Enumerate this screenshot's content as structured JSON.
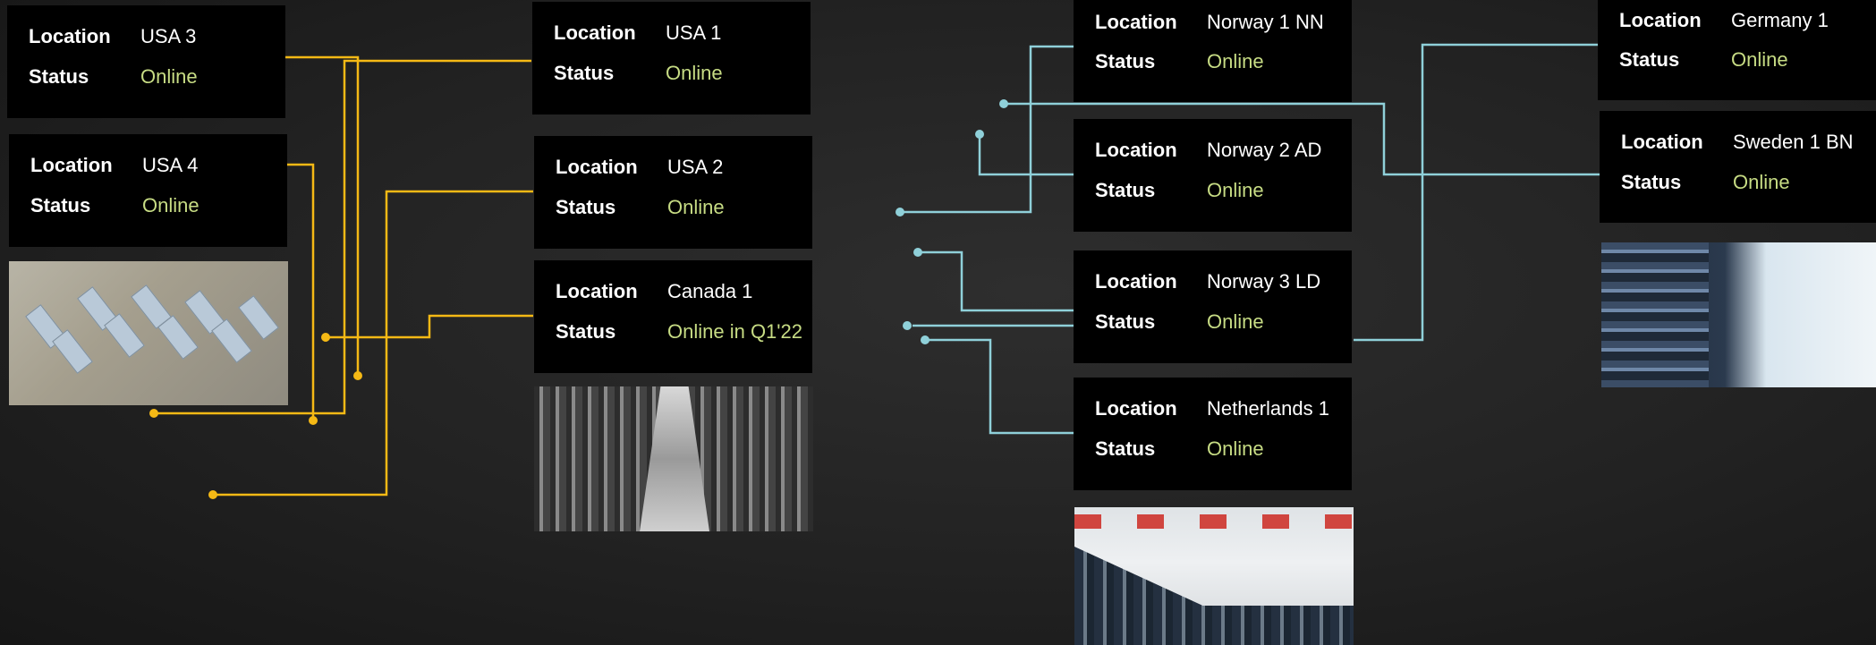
{
  "labels": {
    "location": "Location",
    "status": "Status"
  },
  "colors": {
    "americas_line": "#f5b915",
    "europe_line": "#8fd0d9",
    "status_text": "#c7dc84",
    "card_bg": "#000000"
  },
  "sites": [
    {
      "id": "usa3",
      "location": "USA 3",
      "status": "Online",
      "region": "americas"
    },
    {
      "id": "usa4",
      "location": "USA 4",
      "status": "Online",
      "region": "americas"
    },
    {
      "id": "usa1",
      "location": "USA 1",
      "status": "Online",
      "region": "americas"
    },
    {
      "id": "usa2",
      "location": "USA 2",
      "status": "Online",
      "region": "americas"
    },
    {
      "id": "canada1",
      "location": "Canada 1",
      "status": "Online in Q1'22",
      "region": "americas"
    },
    {
      "id": "norway1",
      "location": "Norway 1 NN",
      "status": "Online",
      "region": "europe"
    },
    {
      "id": "norway2",
      "location": "Norway 2 AD",
      "status": "Online",
      "region": "europe"
    },
    {
      "id": "norway3",
      "location": "Norway 3 LD",
      "status": "Online",
      "region": "europe"
    },
    {
      "id": "netherlands1",
      "location": "Netherlands  1",
      "status": "Online",
      "region": "europe"
    },
    {
      "id": "germany1",
      "location": "Germany 1",
      "status": "Online",
      "region": "europe"
    },
    {
      "id": "sweden1",
      "location": "Sweden 1 BN",
      "status": "Online",
      "region": "europe"
    }
  ],
  "photos": [
    {
      "id": "usa4-site-photo",
      "subject": "aerial view of mining containers"
    },
    {
      "id": "canada-site-photo",
      "subject": "mining rig aisle"
    },
    {
      "id": "netherlands-site-photo",
      "subject": "datacenter hall"
    },
    {
      "id": "sweden-site-photo",
      "subject": "server racks and cables"
    }
  ]
}
